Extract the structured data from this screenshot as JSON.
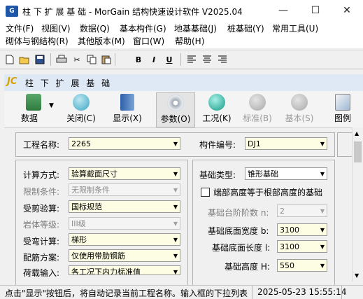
{
  "window": {
    "title": "柱 下 扩 展 基 础 - MorGain 结构快速设计软件 V2025.04",
    "app_icon": "G"
  },
  "menu": [
    "文件(F)",
    "视图(V)",
    "数据(Q)",
    "基本构件(G)",
    "地基基础(J)",
    "桩基础(Y)",
    "常用工具(U)",
    "砌体与钢结构(R)",
    "其他版本(M)",
    "窗口(W)",
    "帮助(H)"
  ],
  "format_toolbar": {
    "bold": "B",
    "italic": "I",
    "underline": "U"
  },
  "panel": {
    "badge": "JC",
    "title": "柱 下 扩 展 基 础"
  },
  "big_toolbar": [
    {
      "label": "数据"
    },
    {
      "label": "关闭(C)"
    },
    {
      "label": "显示(X)"
    },
    {
      "label": "参数(O)"
    },
    {
      "label": "工况(K)"
    },
    {
      "label": "标准(B)"
    },
    {
      "label": "基本(S)"
    },
    {
      "label": "图例"
    }
  ],
  "project": {
    "name_label": "工程名称:",
    "name_value": "2265",
    "id_label": "构件编号:",
    "id_value": "DJ1"
  },
  "left_fields": [
    {
      "label": "计算方式:",
      "value": "验算截面尺寸"
    },
    {
      "label": "限制条件:",
      "value": "无限制条件"
    },
    {
      "label": "受剪验算:",
      "value": "国标规范"
    },
    {
      "label": "岩体等级:",
      "value": "III级"
    },
    {
      "label": "受弯计算:",
      "value": "梯形"
    },
    {
      "label": "配筋方案:",
      "value": "仅使用带肋钢筋"
    },
    {
      "label": "荷载输入:",
      "value": "各工况下内力标准值"
    }
  ],
  "right_fields": {
    "type_label": "基础类型:",
    "type_value": "锥形基础",
    "checkbox_label": "端部高度等于根部高度的基础",
    "steps_label": "基础台阶阶数 n:",
    "steps_value": "2",
    "width_label": "基础底面宽度 b:",
    "width_value": "3100",
    "length_label": "基础底面长度 l:",
    "length_value": "3100",
    "height_label": "基础高度 H:",
    "height_value": "550"
  },
  "status": {
    "message": "点击\"显示\"按钮后，将自动记录当前工程名称。输入框的下拉列表",
    "datetime": "2025-05-23 15:55:14"
  }
}
